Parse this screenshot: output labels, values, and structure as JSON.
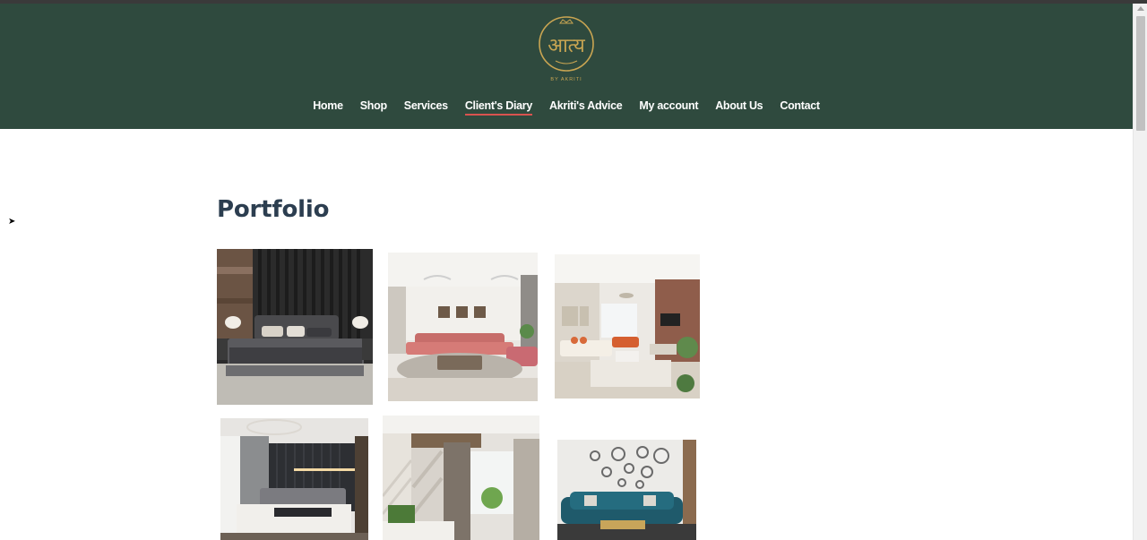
{
  "header": {
    "logo_alt": "Akriti logo",
    "logo_script": "आत्य",
    "logo_tagline": "BY AKRITI",
    "bg_color": "#2f4a3e"
  },
  "nav": {
    "items": [
      {
        "label": "Home"
      },
      {
        "label": "Shop"
      },
      {
        "label": "Services"
      },
      {
        "label": "Client's Diary",
        "active": true
      },
      {
        "label": "Akriti's Advice"
      },
      {
        "label": "My account"
      },
      {
        "label": "About Us"
      },
      {
        "label": "Contact"
      }
    ]
  },
  "main": {
    "title": "Portfolio",
    "gallery": [
      {
        "icon": "bedroom-dark-photo"
      },
      {
        "icon": "living-room-pink-sofa-photo"
      },
      {
        "icon": "living-room-beige-photo"
      },
      {
        "icon": "bedroom-led-photo"
      },
      {
        "icon": "bedroom-curtains-photo"
      },
      {
        "icon": "living-room-blue-sofa-photo"
      }
    ]
  }
}
